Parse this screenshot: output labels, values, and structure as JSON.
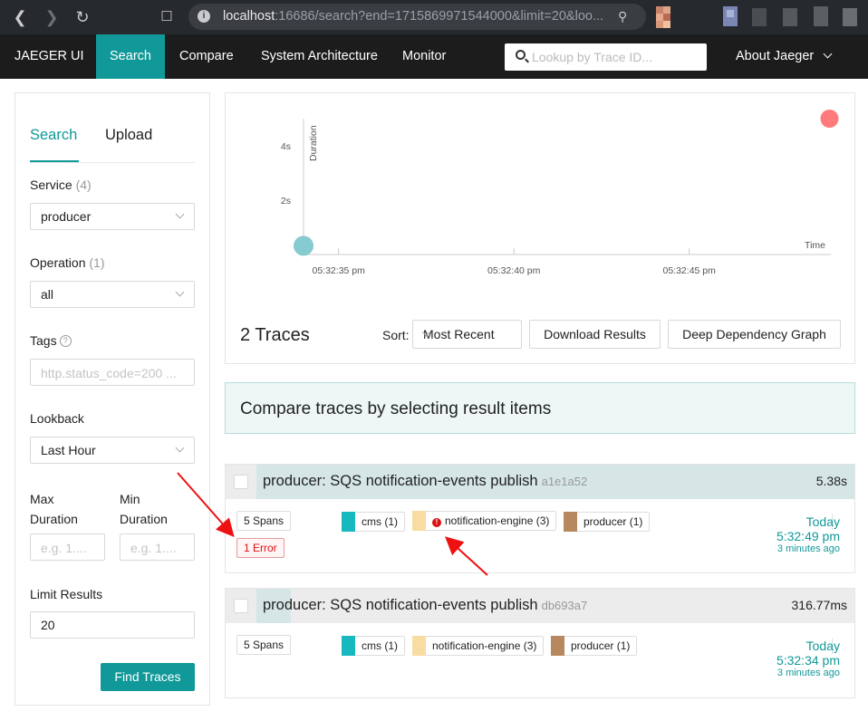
{
  "browser": {
    "url_host": "localhost",
    "url_rest": ":16686/search?end=1715869971544000&limit=20&loo..."
  },
  "topnav": {
    "brand": "JAEGER UI",
    "items": [
      "Search",
      "Compare",
      "System Architecture",
      "Monitor"
    ],
    "lookup_placeholder": "Lookup by Trace ID...",
    "about": "About Jaeger"
  },
  "search_form": {
    "tabs": [
      "Search",
      "Upload"
    ],
    "service_label": "Service",
    "service_count": "(4)",
    "service_value": "producer",
    "operation_label": "Operation",
    "operation_count": "(1)",
    "operation_value": "all",
    "tags_label": "Tags",
    "tags_placeholder": "http.status_code=200 ...",
    "lookback_label": "Lookback",
    "lookback_value": "Last Hour",
    "max_duration_label_1": "Max",
    "max_duration_label_2": "Duration",
    "min_duration_label_1": "Min",
    "min_duration_label_2": "Duration",
    "max_duration_placeholder": "e.g. 1....",
    "min_duration_placeholder": "e.g. 1....",
    "limit_label": "Limit Results",
    "limit_value": "20",
    "find_button": "Find Traces"
  },
  "chart_data": {
    "type": "scatter",
    "ylabel": "Duration",
    "xlabel": "Time",
    "y_ticks": [
      "2s",
      "4s"
    ],
    "x_ticks": [
      "05:32:35 pm",
      "05:32:40 pm",
      "05:32:45 pm"
    ],
    "points": [
      {
        "x": "05:32:34 pm",
        "y_seconds": 0.32,
        "color": "#7ec8cc",
        "error": false
      },
      {
        "x": "05:32:49 pm",
        "y_seconds": 5.38,
        "color": "#ff6b6b",
        "error": true
      }
    ]
  },
  "results": {
    "count_text": "2 Traces",
    "sort_label": "Sort:",
    "sort_value": "Most Recent",
    "download_button": "Download Results",
    "ddg_button": "Deep Dependency Graph",
    "compare_banner": "Compare traces by selecting result items"
  },
  "traces": [
    {
      "title": "producer: SQS notification-events publish",
      "trace_id": "a1e1a52",
      "duration": "5.38s",
      "spans": "5 Spans",
      "errors": "1 Error",
      "services": [
        {
          "name": "cms (1)",
          "color": "#17b8be",
          "error": false
        },
        {
          "name": "notification-engine (3)",
          "color": "#f8dca1",
          "error": true
        },
        {
          "name": "producer (1)",
          "color": "#b7885e",
          "error": false
        }
      ],
      "day": "Today",
      "time": "5:32:49 pm",
      "ago": "3 minutes ago"
    },
    {
      "title": "producer: SQS notification-events publish",
      "trace_id": "db693a7",
      "duration": "316.77ms",
      "spans": "5 Spans",
      "services": [
        {
          "name": "cms (1)",
          "color": "#17b8be",
          "error": false
        },
        {
          "name": "notification-engine (3)",
          "color": "#f8dca1",
          "error": false
        },
        {
          "name": "producer (1)",
          "color": "#b7885e",
          "error": false
        }
      ],
      "day": "Today",
      "time": "5:32:34 pm",
      "ago": "3 minutes ago"
    }
  ],
  "colors": {
    "accent": "#119999",
    "error_red": "#dd1111",
    "annotation_arrow": "#ee1111"
  }
}
